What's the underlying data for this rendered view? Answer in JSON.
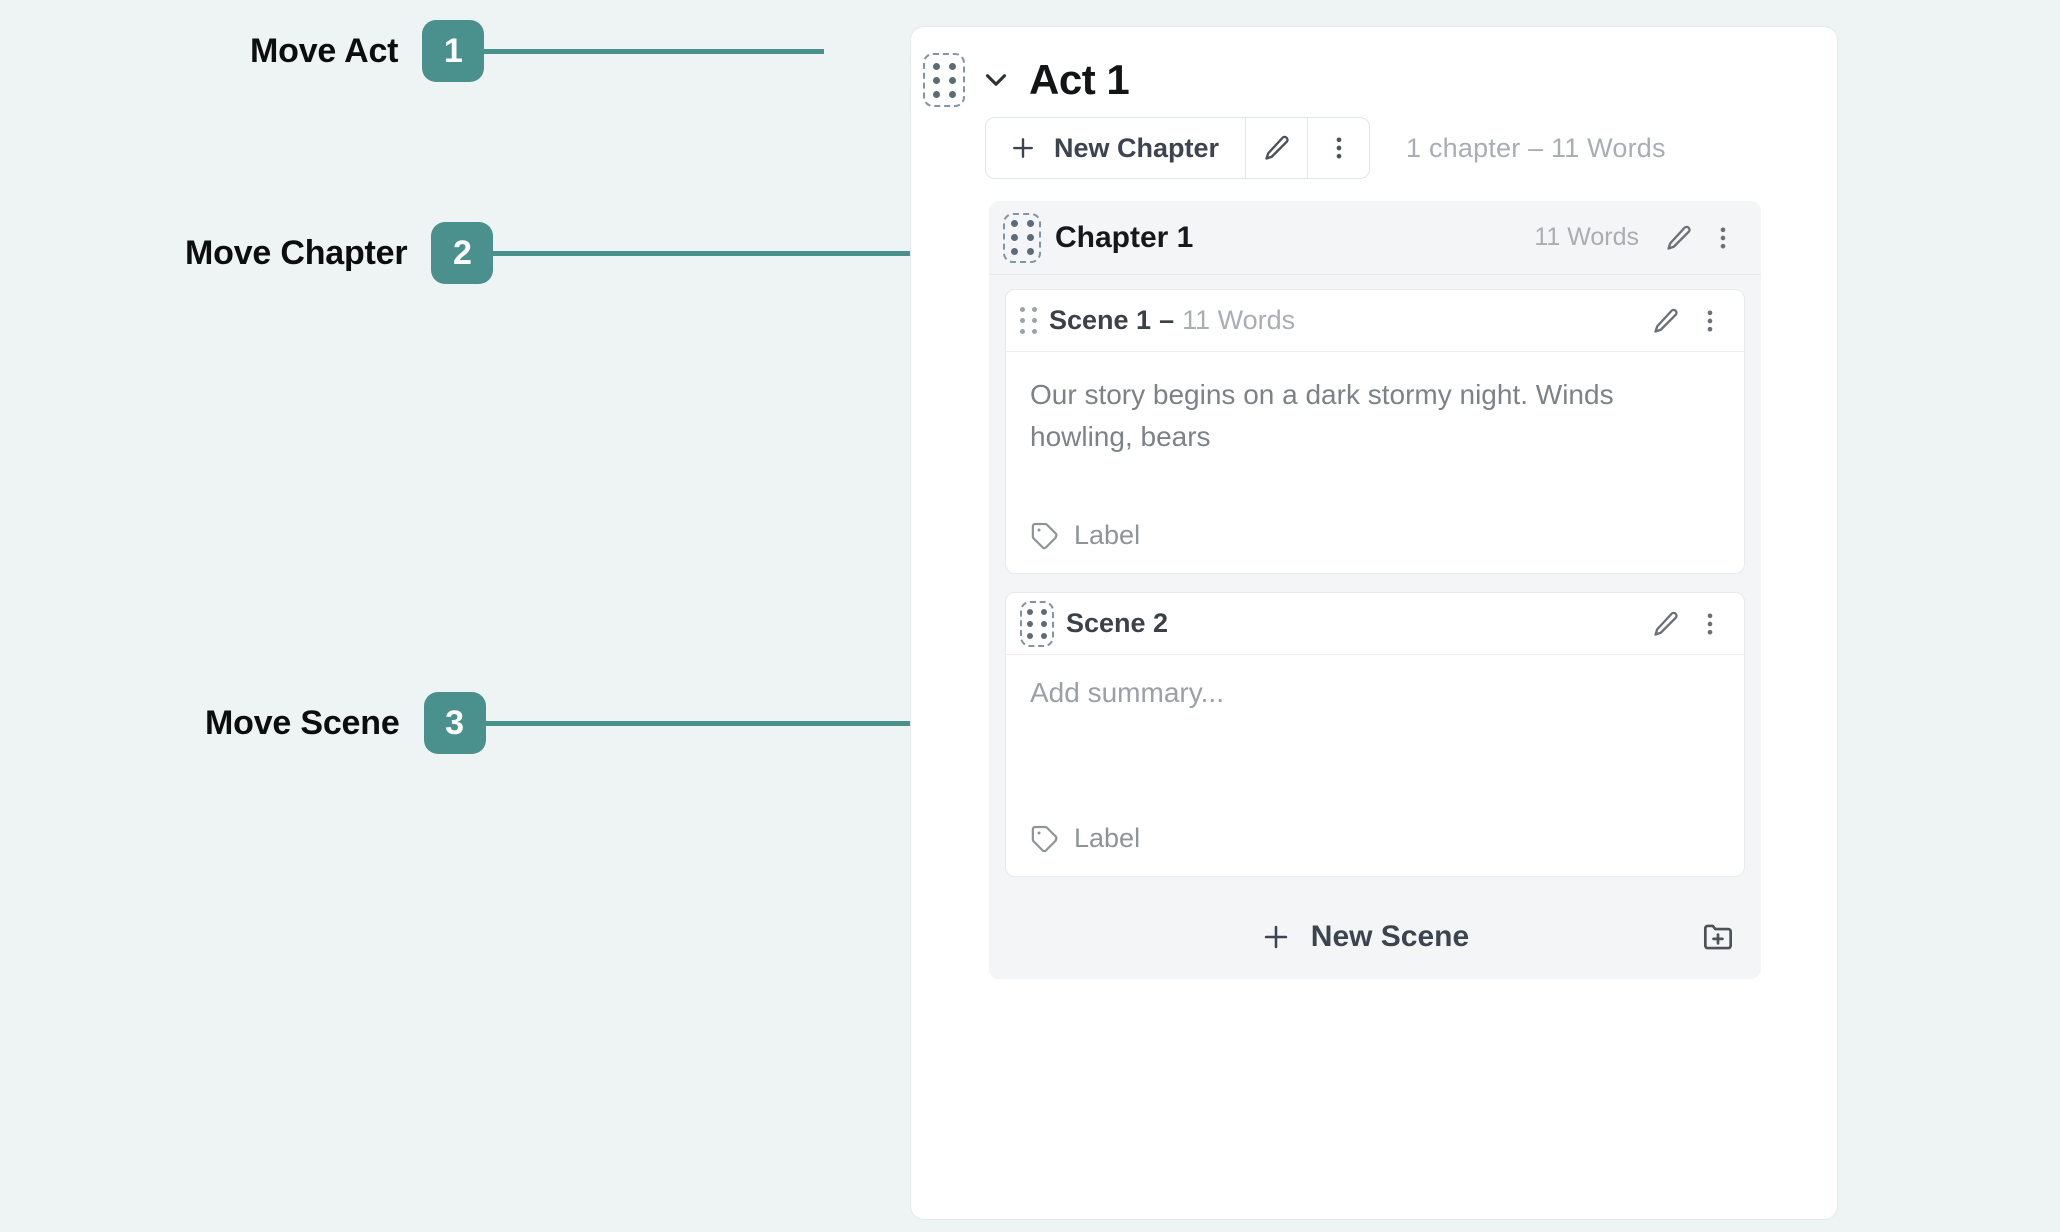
{
  "theme": {
    "background": "#eef3f3",
    "accent": "#4a918e",
    "panel_background": "#ffffff",
    "chapter_background": "#f4f5f6",
    "muted_text": "#a8aeb4",
    "handle_border": "#7e96a5"
  },
  "annotations": [
    {
      "label": "Move Act",
      "number": "1"
    },
    {
      "label": "Move Chapter",
      "number": "2"
    },
    {
      "label": "Move Scene",
      "number": "3"
    }
  ],
  "act": {
    "title": "Act 1",
    "drag_handle_name": "act-drag-handle",
    "collapse_icon": "chevron-down-icon",
    "toolbar": {
      "new_chapter_label": "New Chapter",
      "edit_icon": "pencil-icon",
      "more_icon": "kebab-menu-icon"
    },
    "meta": "1 chapter  –  11 Words"
  },
  "chapter": {
    "title": "Chapter 1",
    "words": "11 Words",
    "edit_icon": "pencil-icon",
    "more_icon": "kebab-menu-icon",
    "scenes": [
      {
        "name": "Scene 1",
        "separator": "–",
        "words": "11 Words",
        "summary": "Our story begins on a dark stormy night. Winds howling, bears",
        "label": "Label",
        "label_icon": "tag-icon",
        "edit_icon": "pencil-icon",
        "more_icon": "kebab-menu-icon",
        "handle_highlighted": false
      },
      {
        "name": "Scene 2",
        "separator": "",
        "words": "",
        "summary": "Add summary...",
        "label": "Label",
        "label_icon": "tag-icon",
        "edit_icon": "pencil-icon",
        "more_icon": "kebab-menu-icon",
        "handle_highlighted": true
      }
    ],
    "footer": {
      "new_scene_label": "New Scene",
      "new_folder_icon": "folder-plus-icon"
    }
  }
}
